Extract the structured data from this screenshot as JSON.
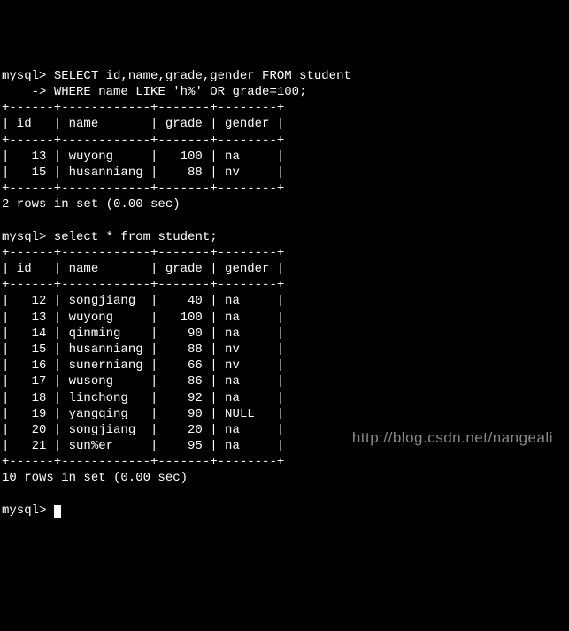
{
  "prompt": "mysql>",
  "cont_prompt": "    ->",
  "query1_line1": " SELECT id,name,grade,gender FROM student",
  "query1_line2": " WHERE name LIKE 'h%' OR grade=100;",
  "table_border_top": "+------+------------+-------+--------+",
  "table_header": "| id   | name       | grade | gender |",
  "result1_rows": [
    "|   13 | wuyong     |   100 | na     |",
    "|   15 | husanniang |    88 | nv     |"
  ],
  "result1_summary": "2 rows in set (0.00 sec)",
  "query2": " select * from student;",
  "result2_rows": [
    "|   12 | songjiang  |    40 | na     |",
    "|   13 | wuyong     |   100 | na     |",
    "|   14 | qinming    |    90 | na     |",
    "|   15 | husanniang |    88 | nv     |",
    "|   16 | sunerniang |    66 | nv     |",
    "|   17 | wusong     |    86 | na     |",
    "|   18 | linchong   |    92 | na     |",
    "|   19 | yangqing   |    90 | NULL   |",
    "|   20 | songjiang  |    20 | na     |",
    "|   21 | sun%er     |    95 | na     |"
  ],
  "result2_summary": "10 rows in set (0.00 sec)",
  "watermark": "http://blog.csdn.net/nangeali",
  "chart_data": [
    {
      "type": "table",
      "title": "Query 1 result",
      "columns": [
        "id",
        "name",
        "grade",
        "gender"
      ],
      "rows": [
        {
          "id": 13,
          "name": "wuyong",
          "grade": 100,
          "gender": "na"
        },
        {
          "id": 15,
          "name": "husanniang",
          "grade": 88,
          "gender": "nv"
        }
      ]
    },
    {
      "type": "table",
      "title": "Query 2 result (student table)",
      "columns": [
        "id",
        "name",
        "grade",
        "gender"
      ],
      "rows": [
        {
          "id": 12,
          "name": "songjiang",
          "grade": 40,
          "gender": "na"
        },
        {
          "id": 13,
          "name": "wuyong",
          "grade": 100,
          "gender": "na"
        },
        {
          "id": 14,
          "name": "qinming",
          "grade": 90,
          "gender": "na"
        },
        {
          "id": 15,
          "name": "husanniang",
          "grade": 88,
          "gender": "nv"
        },
        {
          "id": 16,
          "name": "sunerniang",
          "grade": 66,
          "gender": "nv"
        },
        {
          "id": 17,
          "name": "wusong",
          "grade": 86,
          "gender": "na"
        },
        {
          "id": 18,
          "name": "linchong",
          "grade": 92,
          "gender": "na"
        },
        {
          "id": 19,
          "name": "yangqing",
          "grade": 90,
          "gender": "NULL"
        },
        {
          "id": 20,
          "name": "songjiang",
          "grade": 20,
          "gender": "na"
        },
        {
          "id": 21,
          "name": "sun%er",
          "grade": 95,
          "gender": "na"
        }
      ]
    }
  ]
}
